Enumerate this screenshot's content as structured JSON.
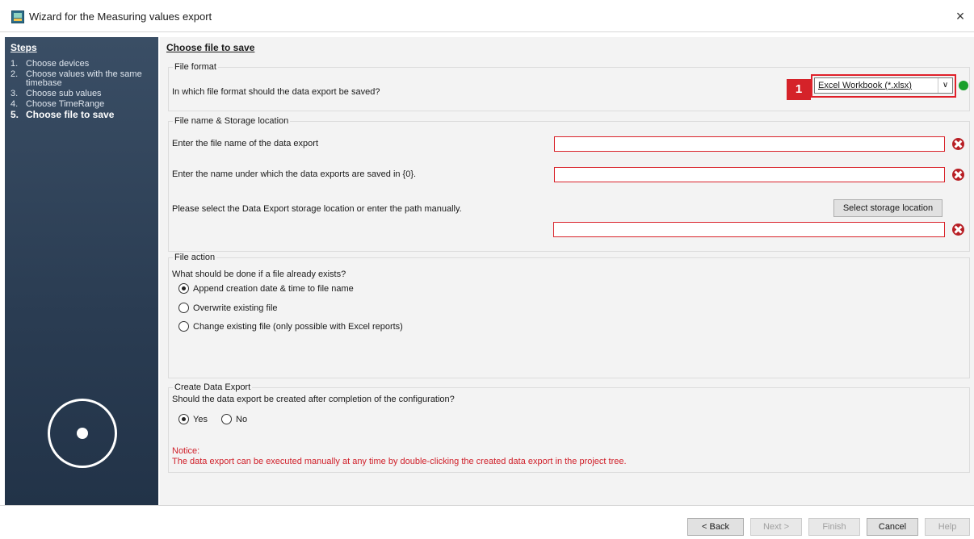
{
  "window": {
    "title": "Wizard for the Measuring values export",
    "close_glyph": "×"
  },
  "sidebar": {
    "heading": "Steps",
    "steps": [
      {
        "num": "1.",
        "label": "Choose devices"
      },
      {
        "num": "2.",
        "label": "Choose values with the same timebase"
      },
      {
        "num": "3.",
        "label": "Choose sub values"
      },
      {
        "num": "4.",
        "label": "Choose TimeRange"
      },
      {
        "num": "5.",
        "label": "Choose file to save"
      }
    ]
  },
  "page": {
    "heading": "Choose file to save"
  },
  "file_format": {
    "legend": "File format",
    "question": "In which file format should the data export be saved?",
    "selected": "Excel Workbook (*.xlsx)",
    "callout_number": "1",
    "dropdown_glyph": "∨"
  },
  "storage": {
    "legend": "File name & Storage location",
    "file_name_label": "Enter the file name of the data export",
    "file_name_value": "",
    "export_name_label": "Enter the name under which the data exports are saved in {0}.",
    "export_name_value": "",
    "location_label": "Please select the Data Export storage location or enter the path manually.",
    "location_button": "Select storage location",
    "location_value": ""
  },
  "file_action": {
    "legend": "File action",
    "question": "What should be done if a file already exists?",
    "options": [
      {
        "label": "Append creation date & time to file name",
        "checked": true
      },
      {
        "label": "Overwrite existing file",
        "checked": false
      },
      {
        "label": "Change existing file (only possible with Excel reports)",
        "checked": false
      }
    ]
  },
  "create_export": {
    "legend": "Create Data Export",
    "question": "Should the data export be created after completion of the configuration?",
    "yes_label": "Yes",
    "no_label": "No",
    "selected": "Yes",
    "notice_title": "Notice:",
    "notice_text": "The data export can be executed manually at any time by double-clicking the created data export in the project tree."
  },
  "buttons": {
    "back": "< Back",
    "next": "Next >",
    "finish": "Finish",
    "cancel": "Cancel",
    "help": "Help"
  },
  "colors": {
    "sidebar_top": "#3a4e65",
    "sidebar_bottom": "#223348",
    "error_red": "#d52229",
    "status_green": "#19a02b"
  }
}
